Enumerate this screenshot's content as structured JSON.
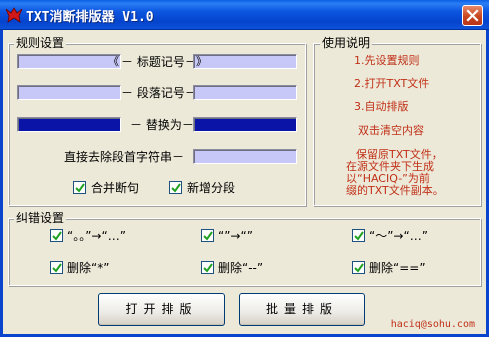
{
  "window": {
    "title": "TXT消断排版器 V1.0",
    "close_glyph": "✕"
  },
  "rules": {
    "group_title": "规则设置",
    "title_mark_label": "－ 标题记号－",
    "title_mark_open": "《",
    "title_mark_close": "》",
    "paragraph_mark_label": "－ 段落记号－",
    "paragraph_mark_open": "",
    "paragraph_mark_close": "",
    "replace_label": "－ 替换为－",
    "replace_from": "",
    "replace_to": "",
    "strip_first_char_label": "直接去除段首字符串－",
    "strip_first_char_value": "",
    "merge_label": "合并断句",
    "merge_checked": true,
    "add_paragraph_label": "新增分段",
    "add_paragraph_checked": true
  },
  "help": {
    "group_title": "使用说明",
    "steps": [
      "1.先设置规则",
      "2.打开TXT文件",
      "3.自动排版"
    ],
    "dbl_click_hint": "双击清空内容",
    "note_lines": [
      "保留原TXT文件，",
      "在源文件夹下生成",
      "以“HACIQ-”为前",
      "缀的TXT文件副本。"
    ]
  },
  "correction": {
    "group_title": "纠错设置",
    "items": [
      {
        "label": "“。。”→“…”",
        "checked": true
      },
      {
        "label": "“”→“”",
        "checked": true
      },
      {
        "label": "“～”→“…”",
        "checked": true
      },
      {
        "label": "删除“*”",
        "checked": true
      },
      {
        "label": "删除“--”",
        "checked": true
      },
      {
        "label": "删除“==”",
        "checked": true
      }
    ]
  },
  "actions": {
    "open_label": "打开排版",
    "batch_label": "批量排版"
  },
  "footer": {
    "email": "haciq@sohu.com"
  },
  "colors": {
    "field_light": "#c8c8f8",
    "field_dark": "#0a14a6",
    "help_text": "#c03018"
  }
}
